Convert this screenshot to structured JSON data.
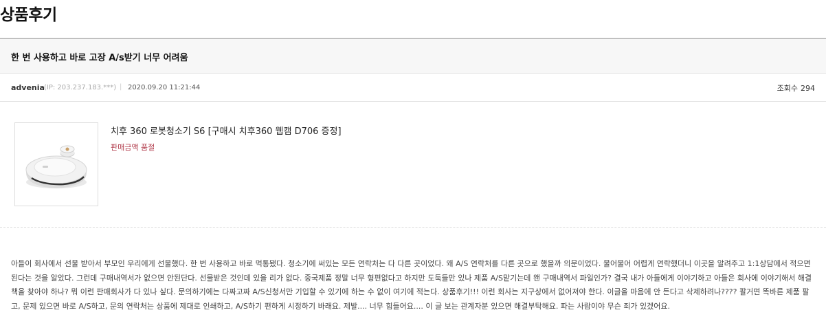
{
  "page": {
    "title": "상품후기"
  },
  "review": {
    "subject": "한 번 사용하고 바로 고장 A/s받기 너무 어려움",
    "author": "advenia",
    "ip": "(IP: 203.237.183.***)",
    "separator": "|",
    "date": "2020.09.20 11:21:44",
    "views_label": "조회수",
    "views_count": "294",
    "body": "아들이 회사에서 선물 받아서 부모인 우리에게 선물했다. 한 번 사용하고 바로 먹통됐다. 청소기에 써있는 모든 연락처는 다 다른 곳이었다. 왜 A/S 연락처를 다른 곳으로 했을까 의문이었다. 물어물어 어렵게 연락했더니 이곳을 알려주고 1:1상담에서 적으면 된다는 것을 알았다. 그런데 구매내역서가 없으면 안된단다. 선물받은 것인데 있을 리가 없다. 중국제품 정말 너무 형편없다고 하지만 도둑들만 있나 제품 A/S맡기는데 왠 구매내역서 파일인가? 결국 내가 아들에게 이야기하고 아들은 회사에 이야기해서 해결책을 찾아야 하나? 뭐 이런 판매회사가 다 있나 싶다. 문의하기에는 다짜고짜 A/S신청서만 기입할 수 있기에 하는 수 없이 여기에 적는다. 상품후기!!! 이런 회사는 지구상에서 없어져야 한다. 이글을 마음에 안 든다고 삭제하려나???? 팔거면 똑바른 제품 팔고, 문제 있으면 바로 A/S하고, 문의 연락처는 상품에 제대로 인쇄하고, A/S하기 편하게 시정하기 바래요. 제발.... 너무 힘들어요.... 이 글 보는 관계자분 있으면 해결부탁해요. 파는 사람이야 무슨 죄가 있겠어요."
  },
  "product": {
    "name": "치후 360 로봇청소기 S6 [구매시 치후360 웹캠 D706 증정]",
    "status": "판매금액 품절",
    "status_color": "#b13b4b",
    "image_icon": "robot-vacuum-image"
  }
}
